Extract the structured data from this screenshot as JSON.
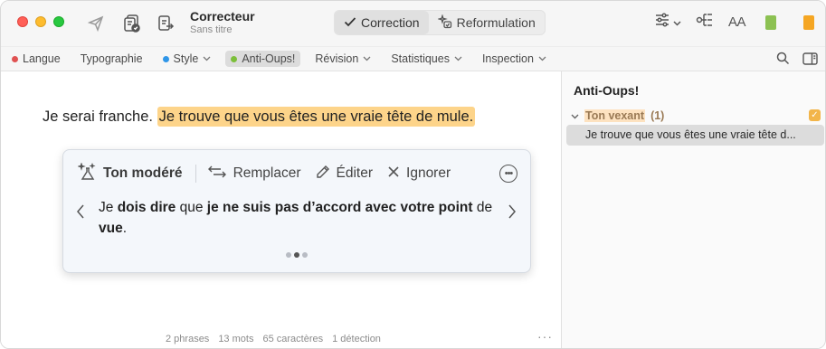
{
  "window": {
    "title": "Correcteur",
    "subtitle": "Sans titre"
  },
  "mode_switch": {
    "correction_label": "Correction",
    "reformulation_label": "Reformulation",
    "active": "correction"
  },
  "right_tools": {
    "text_size_label": "AA"
  },
  "tabs": [
    {
      "label": "Langue",
      "dot_color": "#e05252",
      "has_chevron": false
    },
    {
      "label": "Typographie",
      "dot_color": null,
      "has_chevron": false
    },
    {
      "label": "Style",
      "dot_color": "#2f96e8",
      "has_chevron": true
    },
    {
      "label": "Anti-Oups!",
      "dot_color": "#7cbf3a",
      "has_chevron": false,
      "active": true
    },
    {
      "label": "Révision",
      "dot_color": null,
      "has_chevron": true
    },
    {
      "label": "Statistiques",
      "dot_color": null,
      "has_chevron": true
    },
    {
      "label": "Inspection",
      "dot_color": null,
      "has_chevron": true
    }
  ],
  "editor": {
    "plain_text": "Je serai franche.",
    "highlighted_text": "Je trouve que vous êtes une vraie tête de mule."
  },
  "popover": {
    "title": "Ton modéré",
    "replace_label": "Remplacer",
    "edit_label": "Éditer",
    "ignore_label": "Ignorer",
    "suggestion": {
      "s1": "Je ",
      "s2": "dois dire",
      "s3": " que ",
      "s4": "je ne suis pas d’accord avec votre point",
      "s5": " de ",
      "s6": "vue",
      "s7": "."
    },
    "pager": {
      "total": 3,
      "current": 2
    }
  },
  "status_bar": {
    "phrases": "2 phrases",
    "mots": "13 mots",
    "caracteres": "65 caractères",
    "detection": "1 détection"
  },
  "sidebar": {
    "title": "Anti-Oups!",
    "group_label": "Ton vexant",
    "group_count": "(1)",
    "item_text": "Je trouve que vous êtes une vraie tête d..."
  },
  "colors": {
    "highlight": "#fdd48a",
    "accent_orange": "#f2b54a",
    "book_green": "#8cc152",
    "book_orange": "#f5a623"
  }
}
